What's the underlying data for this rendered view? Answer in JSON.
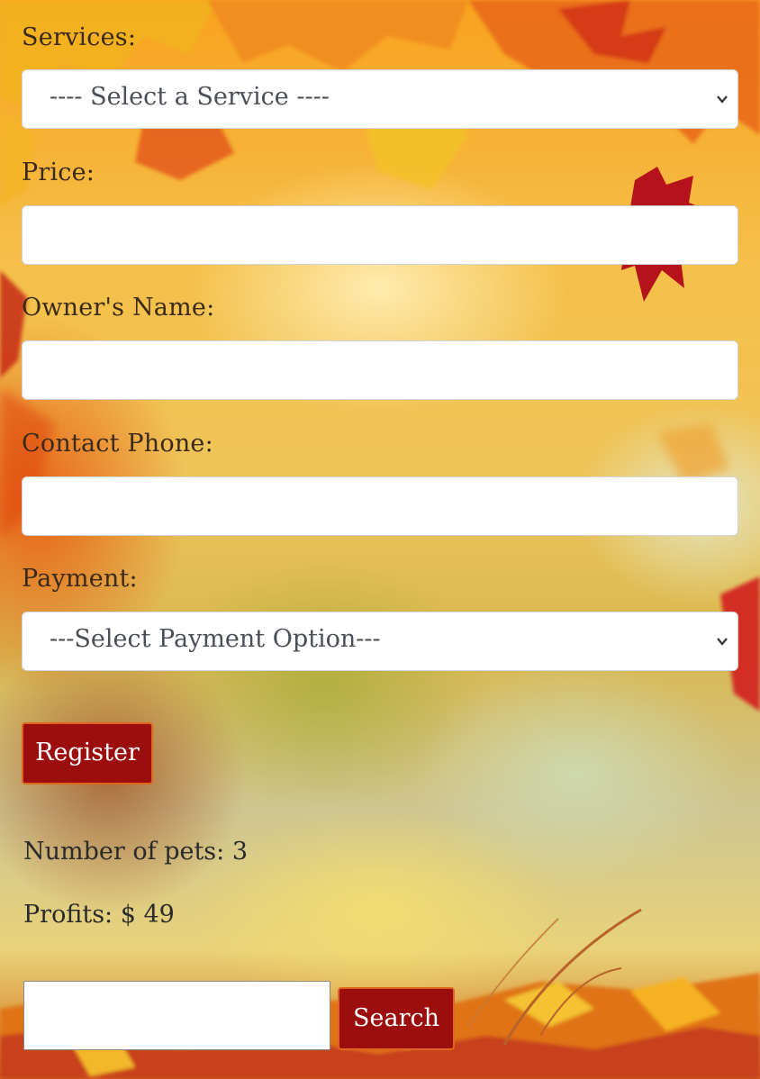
{
  "form": {
    "services": {
      "label": "Services:",
      "selected": "---- Select a Service ----"
    },
    "price": {
      "label": "Price:",
      "value": ""
    },
    "owner": {
      "label": "Owner's Name:",
      "value": ""
    },
    "phone": {
      "label": "Contact Phone:",
      "value": ""
    },
    "payment": {
      "label": "Payment:",
      "selected": "---Select Payment Option---"
    },
    "register_label": "Register"
  },
  "stats": {
    "pets": "Number of pets: 3",
    "profits": "Profits: $ 49"
  },
  "search": {
    "value": "",
    "button_label": "Search"
  },
  "colors": {
    "button_bg": "#9c0d0d",
    "button_border": "#e0661e",
    "input_bg": "#ffffff"
  },
  "icons": {
    "select_arrow": "chevron-down-icon",
    "background": "autumn-leaves"
  }
}
